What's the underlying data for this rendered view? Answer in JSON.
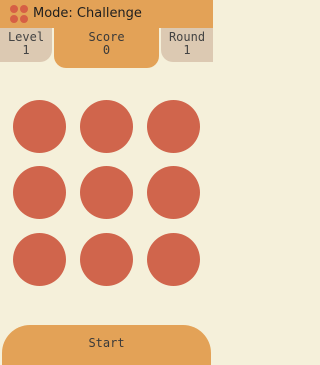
{
  "header": {
    "title": "Mode: Challenge",
    "icon": "app-dots-icon"
  },
  "stats": {
    "level_label": "Level",
    "level_value": "1",
    "score_label": "Score",
    "score_value": "0",
    "round_label": "Round",
    "round_value": "1"
  },
  "board": {
    "rows": 3,
    "columns": 3,
    "circle_color": "#d0654c"
  },
  "footer": {
    "start_label": "Start"
  },
  "colors": {
    "background": "#f5f0da",
    "bar": "#e3a257",
    "side_panel": "#dcc9b2",
    "circle": "#d0654c"
  }
}
